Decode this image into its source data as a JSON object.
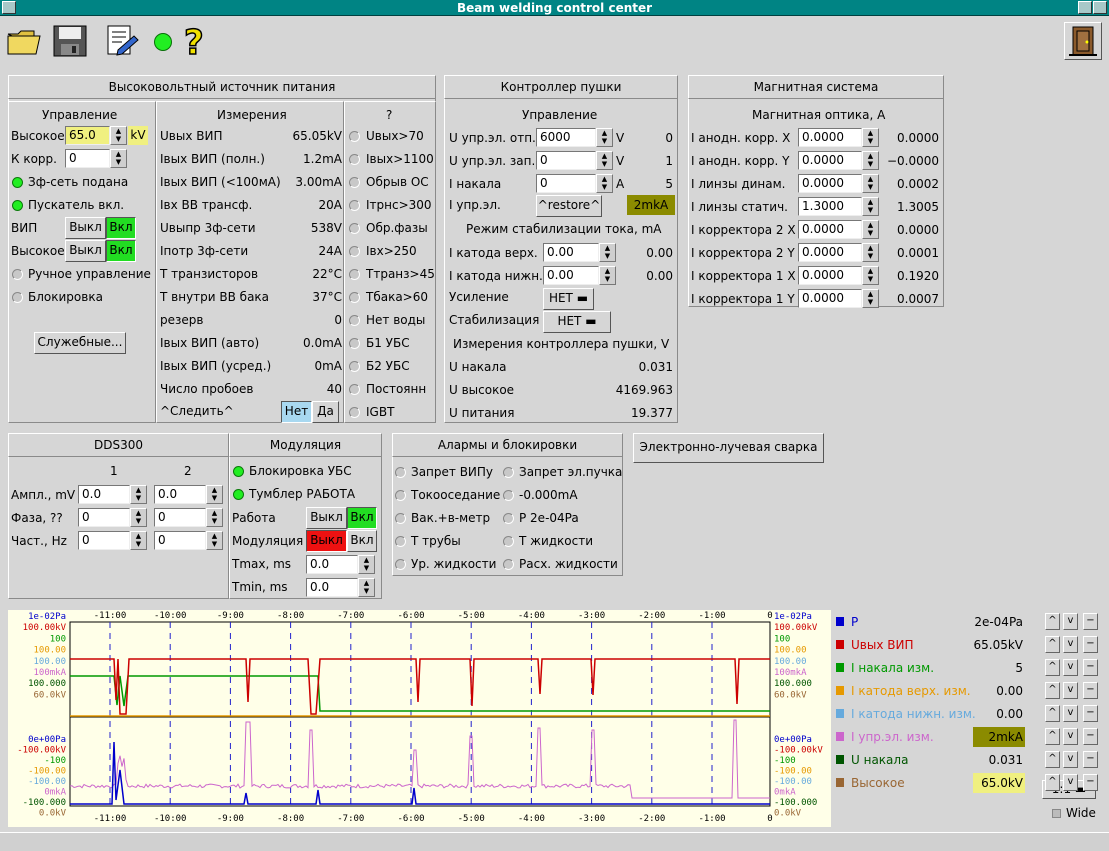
{
  "window": {
    "title": "Beam welding control center"
  },
  "toolbar": {
    "icons": [
      "folder-open-icon",
      "save-icon",
      "edit-document-icon",
      "status-led-icon",
      "help-icon",
      "exit-door-icon"
    ],
    "led_color": "#22ee22"
  },
  "hv": {
    "title": "Высоковольтный источник питания",
    "control": {
      "title": "Управление",
      "vysokoe_label": "Высокое",
      "vysokoe_value": "65.0",
      "vysokoe_unit": "kV",
      "kkorr_label": "К корр.",
      "kkorr_value": "0",
      "led1": "Зф-сеть подана",
      "led2": "Пускатель вкл.",
      "vip_label": "ВИП",
      "vysokoe2_label": "Высокое",
      "off": "Выкл",
      "on": "Вкл",
      "manual": "Ручное управление",
      "block": "Блокировка",
      "service_btn": "Служебные..."
    },
    "meas": {
      "title": "Измерения",
      "rows": [
        {
          "label": "Uвых ВИП",
          "value": "65.05kV"
        },
        {
          "label": "Iвых ВИП (полн.)",
          "value": "1.2mA"
        },
        {
          "label": "Iвых ВИП (<100мА)",
          "value": "3.00mA"
        },
        {
          "label": "Iвх ВВ трансф.",
          "value": "20A"
        },
        {
          "label": "Uвыпр 3ф-сети",
          "value": "538V"
        },
        {
          "label": "Iпотр 3ф-сети",
          "value": "24A"
        },
        {
          "label": "T транзисторов",
          "value": "22°C"
        },
        {
          "label": "T внутри ВВ бака",
          "value": "37°C"
        },
        {
          "label": "резерв",
          "value": "0"
        },
        {
          "label": "Iвых ВИП (авто)",
          "value": "0.0mA"
        },
        {
          "label": "Iвых ВИП (усред.)",
          "value": "0mA"
        },
        {
          "label": "Число пробоев",
          "value": "40"
        }
      ],
      "follow_label": "^Следить^",
      "follow_no": "Нет",
      "follow_yes": "Да"
    },
    "status": {
      "title": "?",
      "items": [
        "Uвых>70",
        "Iвых>1100",
        "Обрыв ОС",
        "Iтрнс>300",
        "Обр.фазы",
        "Iвх>250",
        "Tтранз>45",
        "Tбака>60",
        "Нет воды",
        "Б1 УБС",
        "Б2 УБС",
        "Постоянн",
        "IGBT"
      ]
    }
  },
  "gun": {
    "title": "Контроллер пушки",
    "control_title": "Управление",
    "rows": [
      {
        "label": "U упр.эл. отп.",
        "value": "6000",
        "unit": "V",
        "readout": "0"
      },
      {
        "label": "U упр.эл. зап.",
        "value": "0",
        "unit": "V",
        "readout": "1"
      },
      {
        "label": "I накала",
        "value": "0",
        "unit": "A",
        "readout": "5"
      }
    ],
    "iupr_label": "I упр.эл.",
    "restore_btn": "^restore^",
    "iupr_value": "2mkA",
    "stab_title": "Режим стабилизации тока, mA",
    "stab_rows": [
      {
        "label": "I катода верх.",
        "value": "0.00",
        "readout": "0.00"
      },
      {
        "label": "I катода нижн.",
        "value": "0.00",
        "readout": "0.00"
      }
    ],
    "gain_label": "Усиление",
    "gain_value": "НЕТ",
    "stabil_label": "Стабилизация",
    "stabil_value": "НЕТ",
    "meas_title": "Измерения контроллера пушки, V",
    "meas": [
      {
        "label": "U накала",
        "value": "0.031"
      },
      {
        "label": "U высокое",
        "value": "4169.963"
      },
      {
        "label": "U питания",
        "value": "19.377"
      }
    ]
  },
  "mag": {
    "title": "Магнитная система",
    "sub": "Магнитная оптика, А",
    "rows": [
      {
        "label": "I анодн. корр. X",
        "value": "0.0000",
        "readout": "0.0000"
      },
      {
        "label": "I анодн. корр. Y",
        "value": "0.0000",
        "readout": "−0.0000"
      },
      {
        "label": "I линзы динам.",
        "value": "0.0000",
        "readout": "0.0002"
      },
      {
        "label": "I линзы статич.",
        "value": "1.3000",
        "readout": "1.3005"
      },
      {
        "label": "I корректора 2 X",
        "value": "0.0000",
        "readout": "0.0000"
      },
      {
        "label": "I корректора 2 Y",
        "value": "0.0000",
        "readout": "0.0001"
      },
      {
        "label": "I корректора 1 X",
        "value": "0.0000",
        "readout": "0.1920"
      },
      {
        "label": "I корректора 1 Y",
        "value": "0.0000",
        "readout": "0.0007"
      }
    ]
  },
  "dds": {
    "title": "DDS300",
    "col1": "1",
    "col2": "2",
    "rows": [
      {
        "label": "Ампл., mV",
        "v1": "0.0",
        "v2": "0.0"
      },
      {
        "label": "Фаза, ??",
        "v1": "0",
        "v2": "0"
      },
      {
        "label": "Част., Hz",
        "v1": "0",
        "v2": "0"
      }
    ]
  },
  "mod": {
    "title": "Модуляция",
    "led1": "Блокировка УБС",
    "led2": "Тумблер РАБОТА",
    "work_label": "Работа",
    "mod_label": "Модуляция",
    "off": "Выкл",
    "on": "Вкл",
    "tmax_label": "Tmax, ms",
    "tmax_value": "0.0",
    "tmin_label": "Tmin, ms",
    "tmin_value": "0.0"
  },
  "alarms": {
    "title": "Алармы и блокировки",
    "left": [
      "Запрет ВИПу",
      "Токооседание",
      "Вак.+в-метр",
      "T трубы",
      "Ур. жидкости"
    ],
    "right": [
      "Запрет эл.пучка",
      "-0.000mA",
      "P 2e-04Pa",
      "T жидкости",
      "Расх. жидкости"
    ]
  },
  "ebw_button": "Электронно-лучевая сварка",
  "plot": {
    "x_ticks": [
      "-11:00",
      "-10:00",
      "-9:00",
      "-8:00",
      "-7:00",
      "-6:00",
      "-5:00",
      "-4:00",
      "-3:00",
      "-2:00",
      "-1:00",
      "0"
    ],
    "top_scale": {
      "p": "1e-02Pa",
      "u": "100.00kV",
      "inak": "100",
      "icv": "100.00",
      "icn": "100.00",
      "iupr": "100mkA",
      "hi": "100.000",
      "vys": "60.0kV"
    },
    "mid_scale": {
      "p": "0e+00Pa",
      "u": "-100.00kV",
      "inak": "-100",
      "icv": "-100.00",
      "icn": "-100.00",
      "iupr": "0mkA",
      "hi": "-100.000",
      "vys": "0.0kV"
    },
    "right_top": {
      "p": "1e-02Pa",
      "u": "100.00kV",
      "inak": "100",
      "icv": "100.00",
      "icn": "100.00",
      "iupr": "100mkA",
      "hi": "100.000",
      "vys": "60.0kV"
    },
    "right_mid": {
      "p": "0e+00Pa",
      "u": "-100.00kV",
      "inak": "-100",
      "icv": "-100.00",
      "icn": "-100.00",
      "iupr": "0mkA",
      "hi": "-100.000",
      "vys": "0.0kV"
    },
    "colors": {
      "p": "#0000cc",
      "u": "#cc0000",
      "inak": "#009900",
      "icv": "#e69900",
      "icn": "#66aadd",
      "iupr": "#cc66cc",
      "hi": "#005500",
      "vys": "#996633"
    }
  },
  "legend": [
    {
      "name": "P",
      "value": "2e-04Pa",
      "color": "#0000cc",
      "hl": ""
    },
    {
      "name": "Uвых ВИП",
      "value": "65.05kV",
      "color": "#cc0000",
      "hl": ""
    },
    {
      "name": "I накала изм.",
      "value": "5",
      "color": "#009900",
      "hl": ""
    },
    {
      "name": "I катода верх. изм.",
      "value": "0.00",
      "color": "#e69900",
      "hl": ""
    },
    {
      "name": "I катода нижн. изм.",
      "value": "0.00",
      "color": "#66aadd",
      "hl": ""
    },
    {
      "name": "I упр.эл. изм.",
      "value": "2mkA",
      "color": "#cc66cc",
      "hl": "#8b8b00"
    },
    {
      "name": "U накала",
      "value": "0.031",
      "color": "#005500",
      "hl": ""
    },
    {
      "name": "Высокое",
      "value": "65.0kV",
      "color": "#996633",
      "hl": "#f0f080"
    }
  ],
  "legend_ctrls": {
    "up": "^",
    "down": "v",
    "minus": "−",
    "scale": "1:1",
    "wide": "Wide"
  }
}
